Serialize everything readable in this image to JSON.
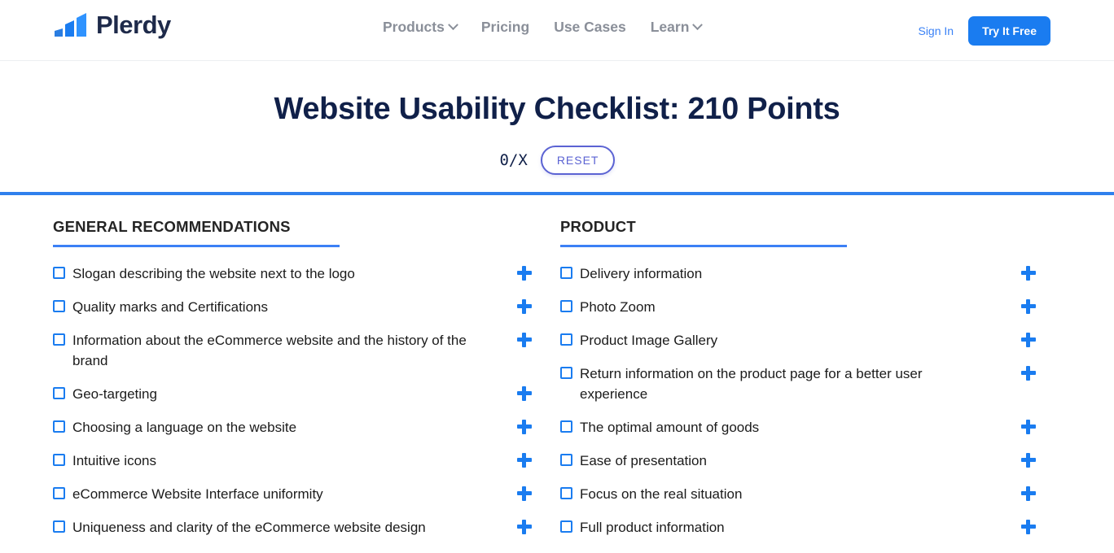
{
  "header": {
    "logo": {
      "text": "Plerdy",
      "icon": "bar-chart-logo-icon",
      "color": "#1a7cf0"
    },
    "nav": [
      {
        "label": "Products",
        "has_dropdown": true
      },
      {
        "label": "Pricing",
        "has_dropdown": false
      },
      {
        "label": "Use Cases",
        "has_dropdown": false
      },
      {
        "label": "Learn",
        "has_dropdown": true
      }
    ],
    "sign_in_label": "Sign In",
    "cta_label": "Try It Free"
  },
  "page": {
    "title": "Website Usability Checklist: 210 Points",
    "counter": "0/X",
    "reset_label": "RESET"
  },
  "columns": [
    {
      "heading": "GENERAL RECOMMENDATIONS",
      "items": [
        "Slogan describing the website next to the logo",
        "Quality marks and Certifications",
        "Information about the eCommerce website and the history of the brand",
        "Geo-targeting",
        "Choosing a language on the website",
        "Intuitive icons",
        "eCommerce Website Interface uniformity",
        "Uniqueness and clarity of the eCommerce website design"
      ]
    },
    {
      "heading": "PRODUCT",
      "items": [
        "Delivery information",
        "Photo Zoom",
        "Product Image Gallery",
        "Return information on the product page for a better user experience",
        "The optimal amount of goods",
        "Ease of presentation",
        "Focus on the real situation",
        "Full product information"
      ]
    }
  ],
  "colors": {
    "brand_blue": "#1a7cf0",
    "rule_blue": "#2f80ed",
    "title_navy": "#102049",
    "reset_indigo": "#5b63d3",
    "nav_gray": "#8a8f99"
  }
}
